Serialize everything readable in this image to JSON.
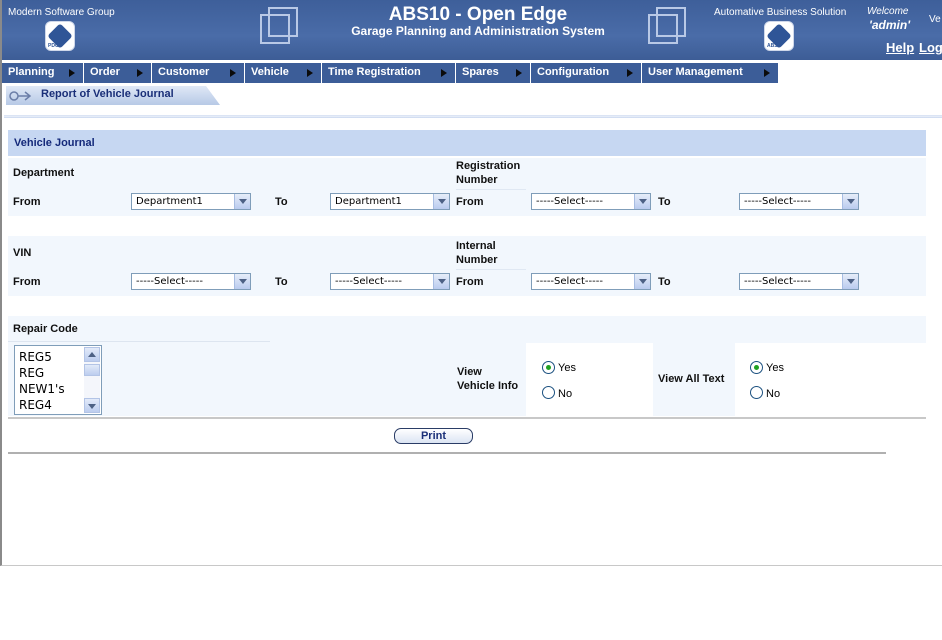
{
  "header": {
    "company": "Modern Software Group",
    "app_title": "ABS10 - Open Edge",
    "app_subtitle": "Garage Planning and Administration System",
    "abs_text": "Automative Business Solution",
    "welcome": "Welcome",
    "version_fragment": "Ve",
    "username": "'admin'",
    "help": "Help",
    "logout": "Log"
  },
  "menu": [
    {
      "label": "Planning"
    },
    {
      "label": "Order"
    },
    {
      "label": "Customer"
    },
    {
      "label": "Vehicle"
    },
    {
      "label": "Time Registration"
    },
    {
      "label": "Spares"
    },
    {
      "label": "Configuration"
    },
    {
      "label": "User Management"
    }
  ],
  "breadcrumb": "Report of Vehicle Journal",
  "panel": {
    "title": "Vehicle Journal",
    "department": {
      "label": "Department",
      "from_label": "From",
      "to_label": "To",
      "from_value": "Department1",
      "to_value": "Department1"
    },
    "registration": {
      "label_line1": "Registration",
      "label_line2": "Number",
      "from_label": "From",
      "to_label": "To",
      "from_value": "-----Select-----",
      "to_value": "-----Select-----"
    },
    "vin": {
      "label": "VIN",
      "from_label": "From",
      "to_label": "To",
      "from_value": "-----Select-----",
      "to_value": "-----Select-----"
    },
    "internal": {
      "label_line1": "Internal",
      "label_line2": "Number",
      "from_label": "From",
      "to_label": "To",
      "from_value": "-----Select-----",
      "to_value": "-----Select-----"
    },
    "repair_code": {
      "label": "Repair Code",
      "items": [
        "REG5",
        "REG",
        "NEW1's",
        "REG4"
      ]
    },
    "view_vehicle_info": {
      "label_line1": "View",
      "label_line2": "Vehicle Info",
      "yes": "Yes",
      "no": "No",
      "selected": "Yes"
    },
    "view_all_text": {
      "label": "View All Text",
      "yes": "Yes",
      "no": "No",
      "selected": "Yes"
    },
    "print": "Print"
  }
}
